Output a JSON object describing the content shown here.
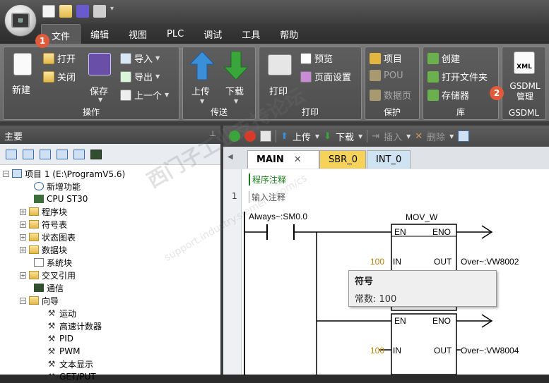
{
  "menubar": {
    "items": [
      "文件",
      "编辑",
      "视图",
      "PLC",
      "调试",
      "工具",
      "帮助"
    ],
    "active": "文件"
  },
  "badges": {
    "one": "1",
    "two": "2"
  },
  "ribbon": {
    "ops": {
      "new": "新建",
      "open": "打开",
      "close": "关闭",
      "save": "保存",
      "import": "导入",
      "export": "导出",
      "previous": "上一个",
      "label": "操作"
    },
    "transfer": {
      "upload": "上传",
      "download": "下载",
      "label": "传送"
    },
    "print": {
      "print": "打印",
      "preview": "预览",
      "page_setup": "页面设置",
      "label": "打印"
    },
    "protect": {
      "project": "项目",
      "pou": "POU",
      "data_page": "数据页",
      "label": "保护"
    },
    "library": {
      "create": "创建",
      "open_folder": "打开文件夹",
      "memory": "存储器",
      "label": "库"
    },
    "gsdml": {
      "icon_text": "XML",
      "manage": "GSDML\n管理",
      "manage_l1": "GSDML",
      "manage_l2": "管理",
      "label": "GSDML"
    }
  },
  "left_panel": {
    "title": "主要",
    "pin": "ᅲ",
    "tree": {
      "root": "项目 1 (E:\\ProgramV5.6)",
      "items": [
        "新增功能",
        "CPU ST30",
        "程序块",
        "符号表",
        "状态图表",
        "数据块",
        "系统块",
        "交叉引用",
        "通信",
        "向导"
      ],
      "wizard_items": [
        "运动",
        "高速计数器",
        "PID",
        "PWM",
        "文本显示",
        "GET/PUT"
      ]
    }
  },
  "editor": {
    "toolbar": {
      "upload": "上传",
      "download": "下载",
      "insert": "插入",
      "delete": "删除"
    },
    "tabs": [
      "MAIN",
      "SBR_0",
      "INT_0"
    ],
    "program_comment": "程序注释",
    "network_number": "1",
    "network_comment": "输入注释",
    "contact_label": "Always~:SM0.0",
    "block1": {
      "name": "MOV_W",
      "en": "EN",
      "eno": "ENO",
      "in_label": "IN",
      "out_label": "OUT",
      "in_value": "100",
      "out_value": "Over~:VW8002"
    },
    "block2": {
      "en": "EN",
      "eno": "ENO",
      "in_label": "IN",
      "out_label": "OUT",
      "in_value": "100",
      "out_value": "Over~:VW8004"
    }
  },
  "tooltip": {
    "title": "符号",
    "body": "常数: 100"
  },
  "watermark": {
    "main": "西门子工业支持论坛",
    "url": "support.industry.siemens.com/cs"
  },
  "colors": {
    "accent_tab": "#f5d35a",
    "badge": "#e05a3c",
    "upload_arrow": "#3b8fd8",
    "download_arrow": "#3aa53a"
  }
}
